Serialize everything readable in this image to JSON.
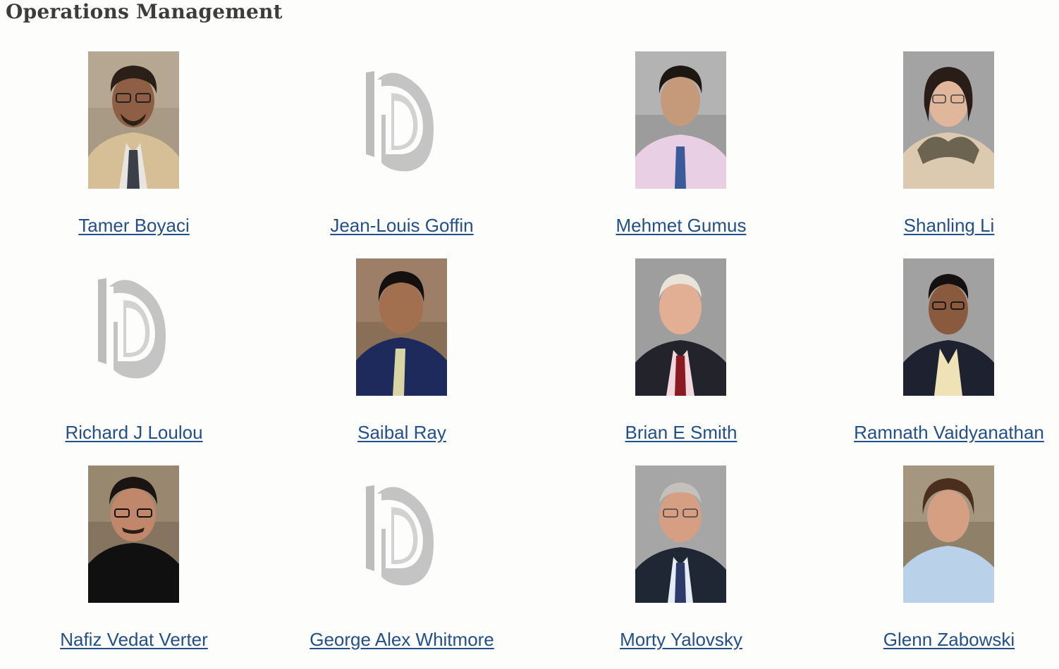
{
  "section": {
    "title": "Operations Management"
  },
  "faculty": [
    {
      "name": "Tamer Boyaci",
      "photo": "photo"
    },
    {
      "name": "Jean-Louis Goffin",
      "photo": "placeholder-logo"
    },
    {
      "name": "Mehmet Gumus",
      "photo": "photo"
    },
    {
      "name": "Shanling Li",
      "photo": "photo"
    },
    {
      "name": "Richard J Loulou",
      "photo": "placeholder-logo"
    },
    {
      "name": "Saibal Ray",
      "photo": "photo"
    },
    {
      "name": "Brian E Smith",
      "photo": "photo"
    },
    {
      "name": "Ramnath Vaidyanathan",
      "photo": "photo"
    },
    {
      "name": "Nafiz Vedat Verter",
      "photo": "photo"
    },
    {
      "name": "George Alex Whitmore",
      "photo": "placeholder-logo"
    },
    {
      "name": "Morty Yalovsky",
      "photo": "photo"
    },
    {
      "name": "Glenn Zabowski",
      "photo": "photo"
    }
  ],
  "colors": {
    "link": "#23508a",
    "title": "#3c3c3c",
    "placeholder_logo": "#bdbdbd"
  }
}
